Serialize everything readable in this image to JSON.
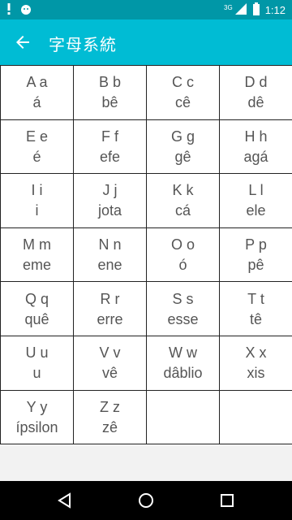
{
  "status_bar": {
    "time": "1:12",
    "network_label": "3G",
    "icons": [
      "alert-icon",
      "android-bug-icon",
      "signal-icon",
      "battery-icon"
    ]
  },
  "app_bar": {
    "title": "字母系統",
    "back_icon": "arrow-left-icon"
  },
  "letters": [
    {
      "upper_lower": "A a",
      "name": "á"
    },
    {
      "upper_lower": "B b",
      "name": "bê"
    },
    {
      "upper_lower": "C c",
      "name": "cê"
    },
    {
      "upper_lower": "D d",
      "name": "dê"
    },
    {
      "upper_lower": "E e",
      "name": "é"
    },
    {
      "upper_lower": "F f",
      "name": "efe"
    },
    {
      "upper_lower": "G g",
      "name": "gê"
    },
    {
      "upper_lower": "H h",
      "name": "agá"
    },
    {
      "upper_lower": "I i",
      "name": "i"
    },
    {
      "upper_lower": "J j",
      "name": "jota"
    },
    {
      "upper_lower": "K k",
      "name": "cá"
    },
    {
      "upper_lower": "L l",
      "name": "ele"
    },
    {
      "upper_lower": "M m",
      "name": "eme"
    },
    {
      "upper_lower": "N n",
      "name": "ene"
    },
    {
      "upper_lower": "O o",
      "name": "ó"
    },
    {
      "upper_lower": "P p",
      "name": "pê"
    },
    {
      "upper_lower": "Q q",
      "name": "quê"
    },
    {
      "upper_lower": "R r",
      "name": "erre"
    },
    {
      "upper_lower": "S s",
      "name": "esse"
    },
    {
      "upper_lower": "T t",
      "name": "tê"
    },
    {
      "upper_lower": "U u",
      "name": "u"
    },
    {
      "upper_lower": "V v",
      "name": "vê"
    },
    {
      "upper_lower": "W w",
      "name": "dâblio"
    },
    {
      "upper_lower": "X x",
      "name": "xis"
    },
    {
      "upper_lower": "Y y",
      "name": "ípsilon"
    },
    {
      "upper_lower": "Z z",
      "name": "zê"
    },
    {
      "upper_lower": "",
      "name": ""
    },
    {
      "upper_lower": "",
      "name": ""
    }
  ],
  "nav_bar": {
    "buttons": [
      "back-triangle-icon",
      "home-circle-icon",
      "recents-square-icon"
    ]
  },
  "colors": {
    "status_bar": "#0097a7",
    "app_bar": "#00bcd4",
    "cell_text": "#555555",
    "grid_border": "#222222"
  }
}
